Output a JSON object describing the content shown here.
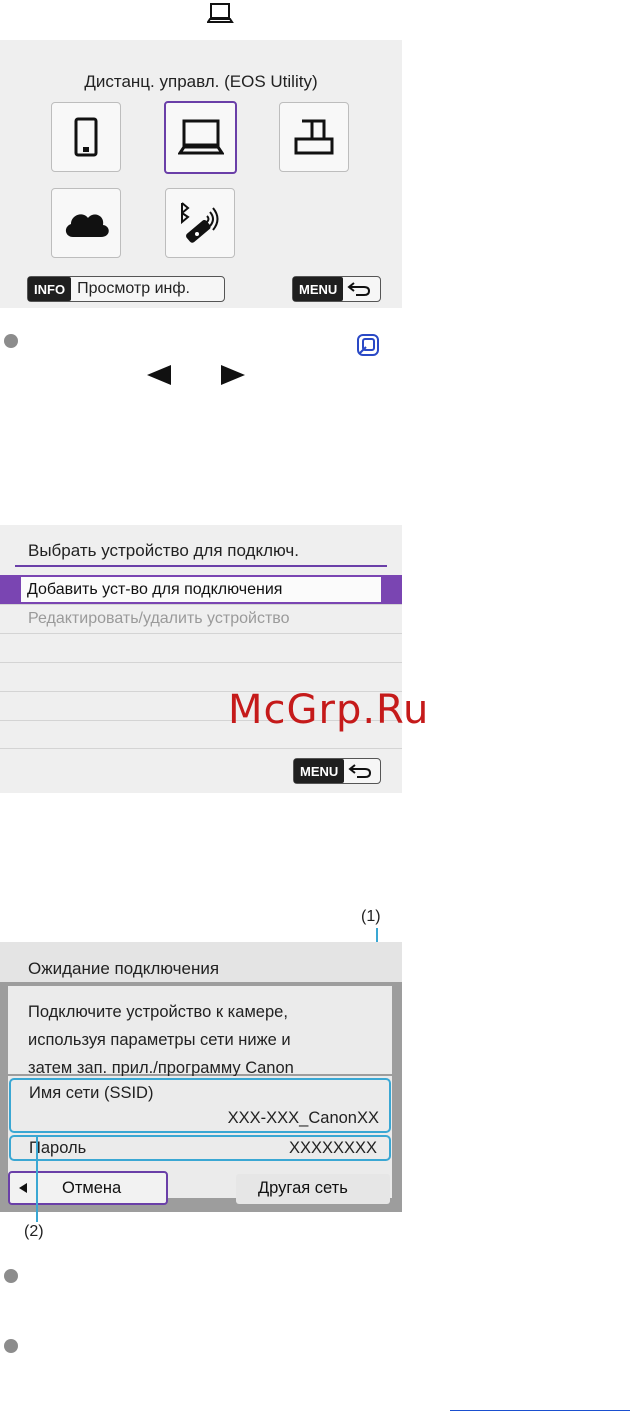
{
  "screen1": {
    "title": "Дистанц. управл. (EOS Utility)",
    "icons": [
      "smartphone-icon",
      "computer-icon",
      "printer-icon",
      "cloud-icon",
      "bluetooth-remote-icon"
    ],
    "selected": "computer-icon",
    "info_key": "INFO",
    "info_label": "Просмотр инф.",
    "menu_key": "MENU"
  },
  "screen2": {
    "title": "Выбрать устройство для подключ.",
    "items": [
      "Добавить уст-во для подключения",
      "Редактировать/удалить устройство"
    ],
    "menu_key": "MENU"
  },
  "screen3": {
    "title": "Ожидание подключения",
    "instructions": [
      "Подключите устройство к камере,",
      "используя параметры сети ниже и",
      "затем зап. прил./программу Canon"
    ],
    "ssid_label": "Имя сети (SSID)",
    "ssid_value": "XXX-XXX_CanonXX",
    "password_label": "Пароль",
    "password_value": "XXXXXXXX",
    "cancel_label": "Отмена",
    "other_network_label": "Другая сеть"
  },
  "callouts": {
    "c1": "(1)",
    "c2": "(2)"
  },
  "watermark": "McGrp.Ru",
  "colors": {
    "accent_purple": "#6a3fa8",
    "callout_blue": "#3aa7d3",
    "bullet": "#8c8c8c",
    "link_blue": "#1a4fcf"
  }
}
